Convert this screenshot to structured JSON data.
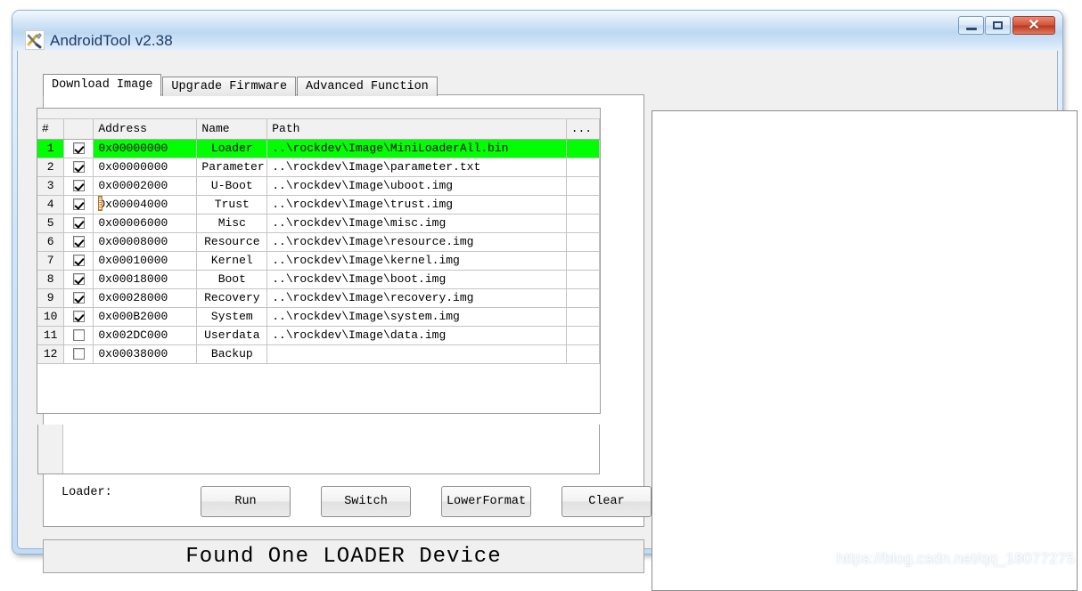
{
  "window": {
    "title": "AndroidTool v2.38",
    "icon": "tools-icon",
    "controls": {
      "minimize": "minimize-icon",
      "maximize": "maximize-icon",
      "close": "✕"
    }
  },
  "tabs": [
    {
      "label": "Download Image",
      "active": true
    },
    {
      "label": "Upgrade Firmware",
      "active": false
    },
    {
      "label": "Advanced Function",
      "active": false
    }
  ],
  "table": {
    "columns": [
      "#",
      "",
      "Address",
      "Name",
      "Path",
      "..."
    ],
    "rows": [
      {
        "index": "1",
        "checked": true,
        "address": "0x00000000",
        "name": "Loader",
        "path": "..\\rockdev\\Image\\MiniLoaderAll.bin",
        "dots": "",
        "highlight": true
      },
      {
        "index": "2",
        "checked": true,
        "address": "0x00000000",
        "name": "Parameter",
        "path": "..\\rockdev\\Image\\parameter.txt",
        "dots": "",
        "highlight": false
      },
      {
        "index": "3",
        "checked": true,
        "address": "0x00002000",
        "name": "U-Boot",
        "path": "..\\rockdev\\Image\\uboot.img",
        "dots": "",
        "highlight": false
      },
      {
        "index": "4",
        "checked": true,
        "address": "0x00004000",
        "name": "Trust",
        "path": "..\\rockdev\\Image\\trust.img",
        "dots": "",
        "highlight": false
      },
      {
        "index": "5",
        "checked": true,
        "address": "0x00006000",
        "name": "Misc",
        "path": "..\\rockdev\\Image\\misc.img",
        "dots": "",
        "highlight": false
      },
      {
        "index": "6",
        "checked": true,
        "address": "0x00008000",
        "name": "Resource",
        "path": "..\\rockdev\\Image\\resource.img",
        "dots": "",
        "highlight": false
      },
      {
        "index": "7",
        "checked": true,
        "address": "0x00010000",
        "name": "Kernel",
        "path": "..\\rockdev\\Image\\kernel.img",
        "dots": "",
        "highlight": false
      },
      {
        "index": "8",
        "checked": true,
        "address": "0x00018000",
        "name": "Boot",
        "path": "..\\rockdev\\Image\\boot.img",
        "dots": "",
        "highlight": false
      },
      {
        "index": "9",
        "checked": true,
        "address": "0x00028000",
        "name": "Recovery",
        "path": "..\\rockdev\\Image\\recovery.img",
        "dots": "",
        "highlight": false
      },
      {
        "index": "10",
        "checked": true,
        "address": "0x000B2000",
        "name": "System",
        "path": "..\\rockdev\\Image\\system.img",
        "dots": "",
        "highlight": false
      },
      {
        "index": "11",
        "checked": false,
        "address": "0x002DC000",
        "name": "Userdata",
        "path": "..\\rockdev\\Image\\data.img",
        "dots": "",
        "highlight": false
      },
      {
        "index": "12",
        "checked": false,
        "address": "0x00038000",
        "name": "Backup",
        "path": "",
        "dots": "",
        "highlight": false
      }
    ]
  },
  "loader": {
    "label": "Loader:",
    "value": ""
  },
  "buttons": [
    {
      "label": "Run"
    },
    {
      "label": "Switch"
    },
    {
      "label": "LowerFormat"
    },
    {
      "label": "Clear"
    }
  ],
  "status": {
    "text": "Found One LOADER Device"
  },
  "log_panel": {
    "content": ""
  },
  "watermark": {
    "text": "https://blog.csdn.net/qq_18077275"
  },
  "colors": {
    "highlight_row": "#00ff00",
    "titlebar_blue": "#bdd8f2",
    "close_red": "#d2533a",
    "client_gray": "#f0f0f0"
  }
}
